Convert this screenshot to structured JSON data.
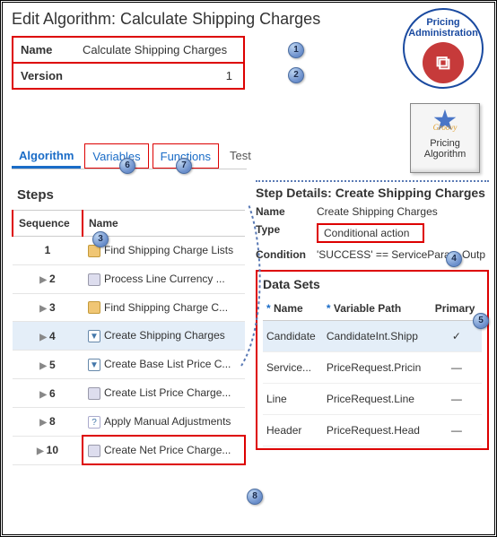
{
  "page_title": "Edit Algorithm: Calculate Shipping Charges",
  "info": {
    "name_label": "Name",
    "name_value": "Calculate Shipping Charges",
    "version_label": "Version",
    "version_value": "1"
  },
  "badges": {
    "pricing_admin": "Pricing Administration",
    "pricing_algo_caption": "Pricing Algorithm",
    "groovy": "Groovy"
  },
  "tabs": {
    "algorithm": "Algorithm",
    "variables": "Variables",
    "functions": "Functions",
    "test": "Test"
  },
  "steps": {
    "title": "Steps",
    "col_sequence": "Sequence",
    "col_name": "Name",
    "rows": [
      {
        "seq": "1",
        "name": "Find Shipping Charge Lists",
        "icon": "folder",
        "expand": false
      },
      {
        "seq": "2",
        "name": "Process Line Currency ...",
        "icon": "nodes",
        "expand": true
      },
      {
        "seq": "3",
        "name": "Find Shipping Charge C...",
        "icon": "folder",
        "expand": true
      },
      {
        "seq": "4",
        "name": "Create Shipping Charges",
        "icon": "funnel",
        "expand": true
      },
      {
        "seq": "5",
        "name": "Create Base List Price C...",
        "icon": "funnel",
        "expand": true
      },
      {
        "seq": "6",
        "name": "Create List Price Charge...",
        "icon": "nodes",
        "expand": true
      },
      {
        "seq": "8",
        "name": "Apply Manual Adjustments",
        "icon": "doc",
        "expand": true
      },
      {
        "seq": "10",
        "name": "Create Net Price Charge...",
        "icon": "nodes",
        "expand": true
      }
    ]
  },
  "details": {
    "title": "Step Details: Create Shipping Charges",
    "name_label": "Name",
    "name_value": "Create Shipping Charges",
    "type_label": "Type",
    "type_value": "Conditional action",
    "condition_label": "Condition",
    "condition_value": "'SUCCESS' == ServiceParam.Outp"
  },
  "datasets": {
    "title": "Data Sets",
    "col_name": "Name",
    "col_varpath": "Variable Path",
    "col_primary": "Primary",
    "rows": [
      {
        "name": "Candidate",
        "path": "CandidateInt.Shipp",
        "primary": "✓"
      },
      {
        "name": "Service...",
        "path": "PriceRequest.Pricin",
        "primary": "—"
      },
      {
        "name": "Line",
        "path": "PriceRequest.Line",
        "primary": "—"
      },
      {
        "name": "Header",
        "path": "PriceRequest.Head",
        "primary": "—"
      }
    ]
  },
  "callouts": {
    "c1": "1",
    "c2": "2",
    "c3": "3",
    "c4": "4",
    "c5": "5",
    "c6": "6",
    "c7": "7",
    "c8": "8"
  }
}
